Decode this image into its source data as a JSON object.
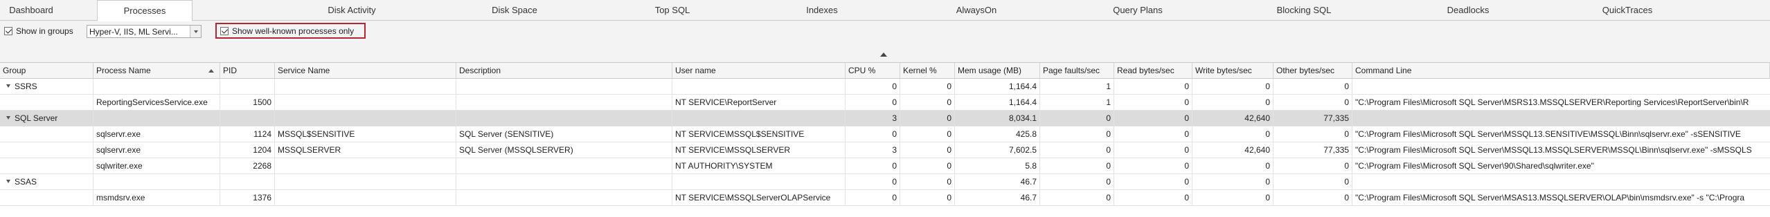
{
  "tabs": [
    {
      "label": "Dashboard"
    },
    {
      "label": "Processes"
    },
    {
      "label": "Disk Activity"
    },
    {
      "label": "Disk Space"
    },
    {
      "label": "Top SQL"
    },
    {
      "label": "Indexes"
    },
    {
      "label": "AlwaysOn"
    },
    {
      "label": "Query Plans"
    },
    {
      "label": "Blocking SQL"
    },
    {
      "label": "Deadlocks"
    },
    {
      "label": "QuickTraces"
    }
  ],
  "active_tab": "Processes",
  "toolbar": {
    "show_in_groups_label": "Show in groups",
    "show_in_groups_checked": true,
    "groups_value": "Hyper-V, IIS, ML Servi...",
    "well_known_label": "Show well-known processes only",
    "well_known_checked": true
  },
  "columns": {
    "group": "Group",
    "process_name": "Process Name",
    "pid": "PID",
    "service_name": "Service Name",
    "description": "Description",
    "user_name": "User name",
    "cpu": "CPU %",
    "kernel": "Kernel %",
    "mem": "Mem usage (MB)",
    "page_faults": "Page faults/sec",
    "read_bytes": "Read bytes/sec",
    "write_bytes": "Write bytes/sec",
    "other_bytes": "Other bytes/sec",
    "command_line": "Command Line"
  },
  "rows": [
    {
      "type": "group",
      "group": "SSRS",
      "process": "",
      "pid": "",
      "service": "",
      "description": "",
      "user": "",
      "cpu": "0",
      "kernel": "0",
      "mem": "1,164.4",
      "pf": "1",
      "read": "0",
      "write": "0",
      "other": "0",
      "cmd": ""
    },
    {
      "type": "child",
      "group": "",
      "process": "ReportingServicesService.exe",
      "pid": "1500",
      "service": "",
      "description": "",
      "user": "NT SERVICE\\ReportServer",
      "cpu": "0",
      "kernel": "0",
      "mem": "1,164.4",
      "pf": "1",
      "read": "0",
      "write": "0",
      "other": "0",
      "cmd": "\"C:\\Program Files\\Microsoft SQL Server\\MSRS13.MSSQLSERVER\\Reporting Services\\ReportServer\\bin\\R"
    },
    {
      "type": "group",
      "selected": true,
      "group": "SQL Server",
      "process": "",
      "pid": "",
      "service": "",
      "description": "",
      "user": "",
      "cpu": "3",
      "kernel": "0",
      "mem": "8,034.1",
      "pf": "0",
      "read": "0",
      "write": "42,640",
      "other": "77,335",
      "cmd": ""
    },
    {
      "type": "child",
      "group": "",
      "process": "sqlservr.exe",
      "pid": "1124",
      "service": "MSSQL$SENSITIVE",
      "description": "SQL Server (SENSITIVE)",
      "user": "NT SERVICE\\MSSQL$SENSITIVE",
      "cpu": "0",
      "kernel": "0",
      "mem": "425.8",
      "pf": "0",
      "read": "0",
      "write": "0",
      "other": "0",
      "cmd": "\"C:\\Program Files\\Microsoft SQL Server\\MSSQL13.SENSITIVE\\MSSQL\\Binn\\sqlservr.exe\" -sSENSITIVE"
    },
    {
      "type": "child",
      "group": "",
      "process": "sqlservr.exe",
      "pid": "1204",
      "service": "MSSQLSERVER",
      "description": "SQL Server (MSSQLSERVER)",
      "user": "NT SERVICE\\MSSQLSERVER",
      "cpu": "3",
      "kernel": "0",
      "mem": "7,602.5",
      "pf": "0",
      "read": "0",
      "write": "42,640",
      "other": "77,335",
      "cmd": "\"C:\\Program Files\\Microsoft SQL Server\\MSSQL13.MSSQLSERVER\\MSSQL\\Binn\\sqlservr.exe\" -sMSSQLS"
    },
    {
      "type": "child",
      "group": "",
      "process": "sqlwriter.exe",
      "pid": "2268",
      "service": "",
      "description": "",
      "user": "NT AUTHORITY\\SYSTEM",
      "cpu": "0",
      "kernel": "0",
      "mem": "5.8",
      "pf": "0",
      "read": "0",
      "write": "0",
      "other": "0",
      "cmd": "\"C:\\Program Files\\Microsoft SQL Server\\90\\Shared\\sqlwriter.exe\""
    },
    {
      "type": "group",
      "group": "SSAS",
      "process": "",
      "pid": "",
      "service": "",
      "description": "",
      "user": "",
      "cpu": "0",
      "kernel": "0",
      "mem": "46.7",
      "pf": "0",
      "read": "0",
      "write": "0",
      "other": "0",
      "cmd": ""
    },
    {
      "type": "child",
      "group": "",
      "process": "msmdsrv.exe",
      "pid": "1376",
      "service": "",
      "description": "",
      "user": "NT SERVICE\\MSSQLServerOLAPService",
      "cpu": "0",
      "kernel": "0",
      "mem": "46.7",
      "pf": "0",
      "read": "0",
      "write": "0",
      "other": "0",
      "cmd": "\"C:\\Program Files\\Microsoft SQL Server\\MSAS13.MSSQLSERVER\\OLAP\\bin\\msmdsrv.exe\" -s \"C:\\Progra"
    }
  ]
}
